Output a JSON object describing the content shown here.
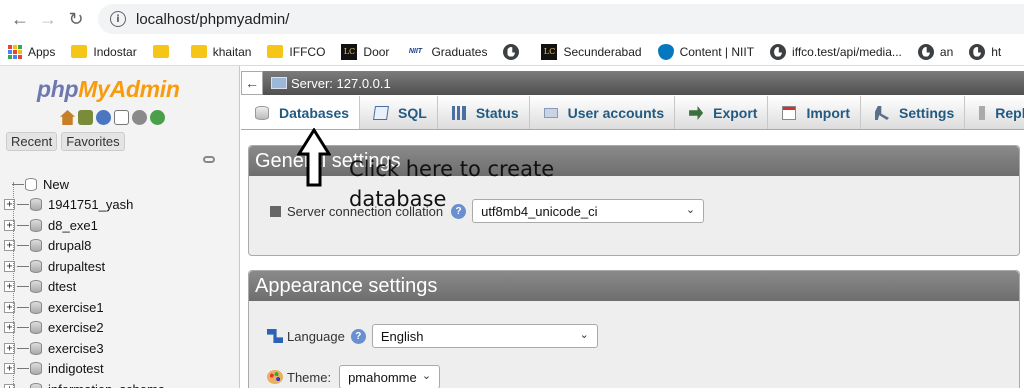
{
  "browser": {
    "url": "localhost/phpmyadmin/",
    "bookmarks": [
      {
        "label": "Apps",
        "icon": "apps-grid-icon"
      },
      {
        "label": "Indostar",
        "icon": "folder-icon"
      },
      {
        "label": "",
        "icon": "folder-icon"
      },
      {
        "label": "khaitan",
        "icon": "folder-icon"
      },
      {
        "label": "IFFCO",
        "icon": "folder-icon"
      },
      {
        "label": "Door",
        "icon": "lc-icon"
      },
      {
        "label": "Graduates",
        "icon": "niit-icon"
      },
      {
        "label": "",
        "icon": "globe-icon"
      },
      {
        "label": "Secunderabad",
        "icon": "lc-icon"
      },
      {
        "label": "Content | NIIT",
        "icon": "drupal-icon"
      },
      {
        "label": "iffco.test/api/media...",
        "icon": "globe-icon"
      },
      {
        "label": "an",
        "icon": "globe-icon"
      },
      {
        "label": "ht",
        "icon": "globe-icon"
      }
    ]
  },
  "sidebar": {
    "logo_php": "php",
    "logo_my": "MyAdmin",
    "tab_recent": "Recent",
    "tab_favorites": "Favorites",
    "new_label": "New",
    "databases": [
      "1941751_yash",
      "d8_exe1",
      "drupal8",
      "drupaltest",
      "dtest",
      "exercise1",
      "exercise2",
      "exercise3",
      "indigotest",
      "information_schema"
    ]
  },
  "server": {
    "label": "Server: 127.0.0.1"
  },
  "menu": {
    "tabs": [
      "Databases",
      "SQL",
      "Status",
      "User accounts",
      "Export",
      "Import",
      "Settings",
      "Replication"
    ]
  },
  "general": {
    "title": "General settings",
    "collation_label": "Server connection collation",
    "collation_value": "utf8mb4_unicode_ci"
  },
  "appearance": {
    "title": "Appearance settings",
    "language_label": "Language",
    "language_value": "English",
    "theme_label": "Theme:",
    "theme_value": "pmahomme"
  },
  "annotation": {
    "line1": "Click here to create",
    "line2": "database"
  },
  "colors": {
    "link": "#235a81",
    "legend_bg": "#777777",
    "logo_php": "#6c78af",
    "logo_myadmin": "#f89c0e"
  }
}
